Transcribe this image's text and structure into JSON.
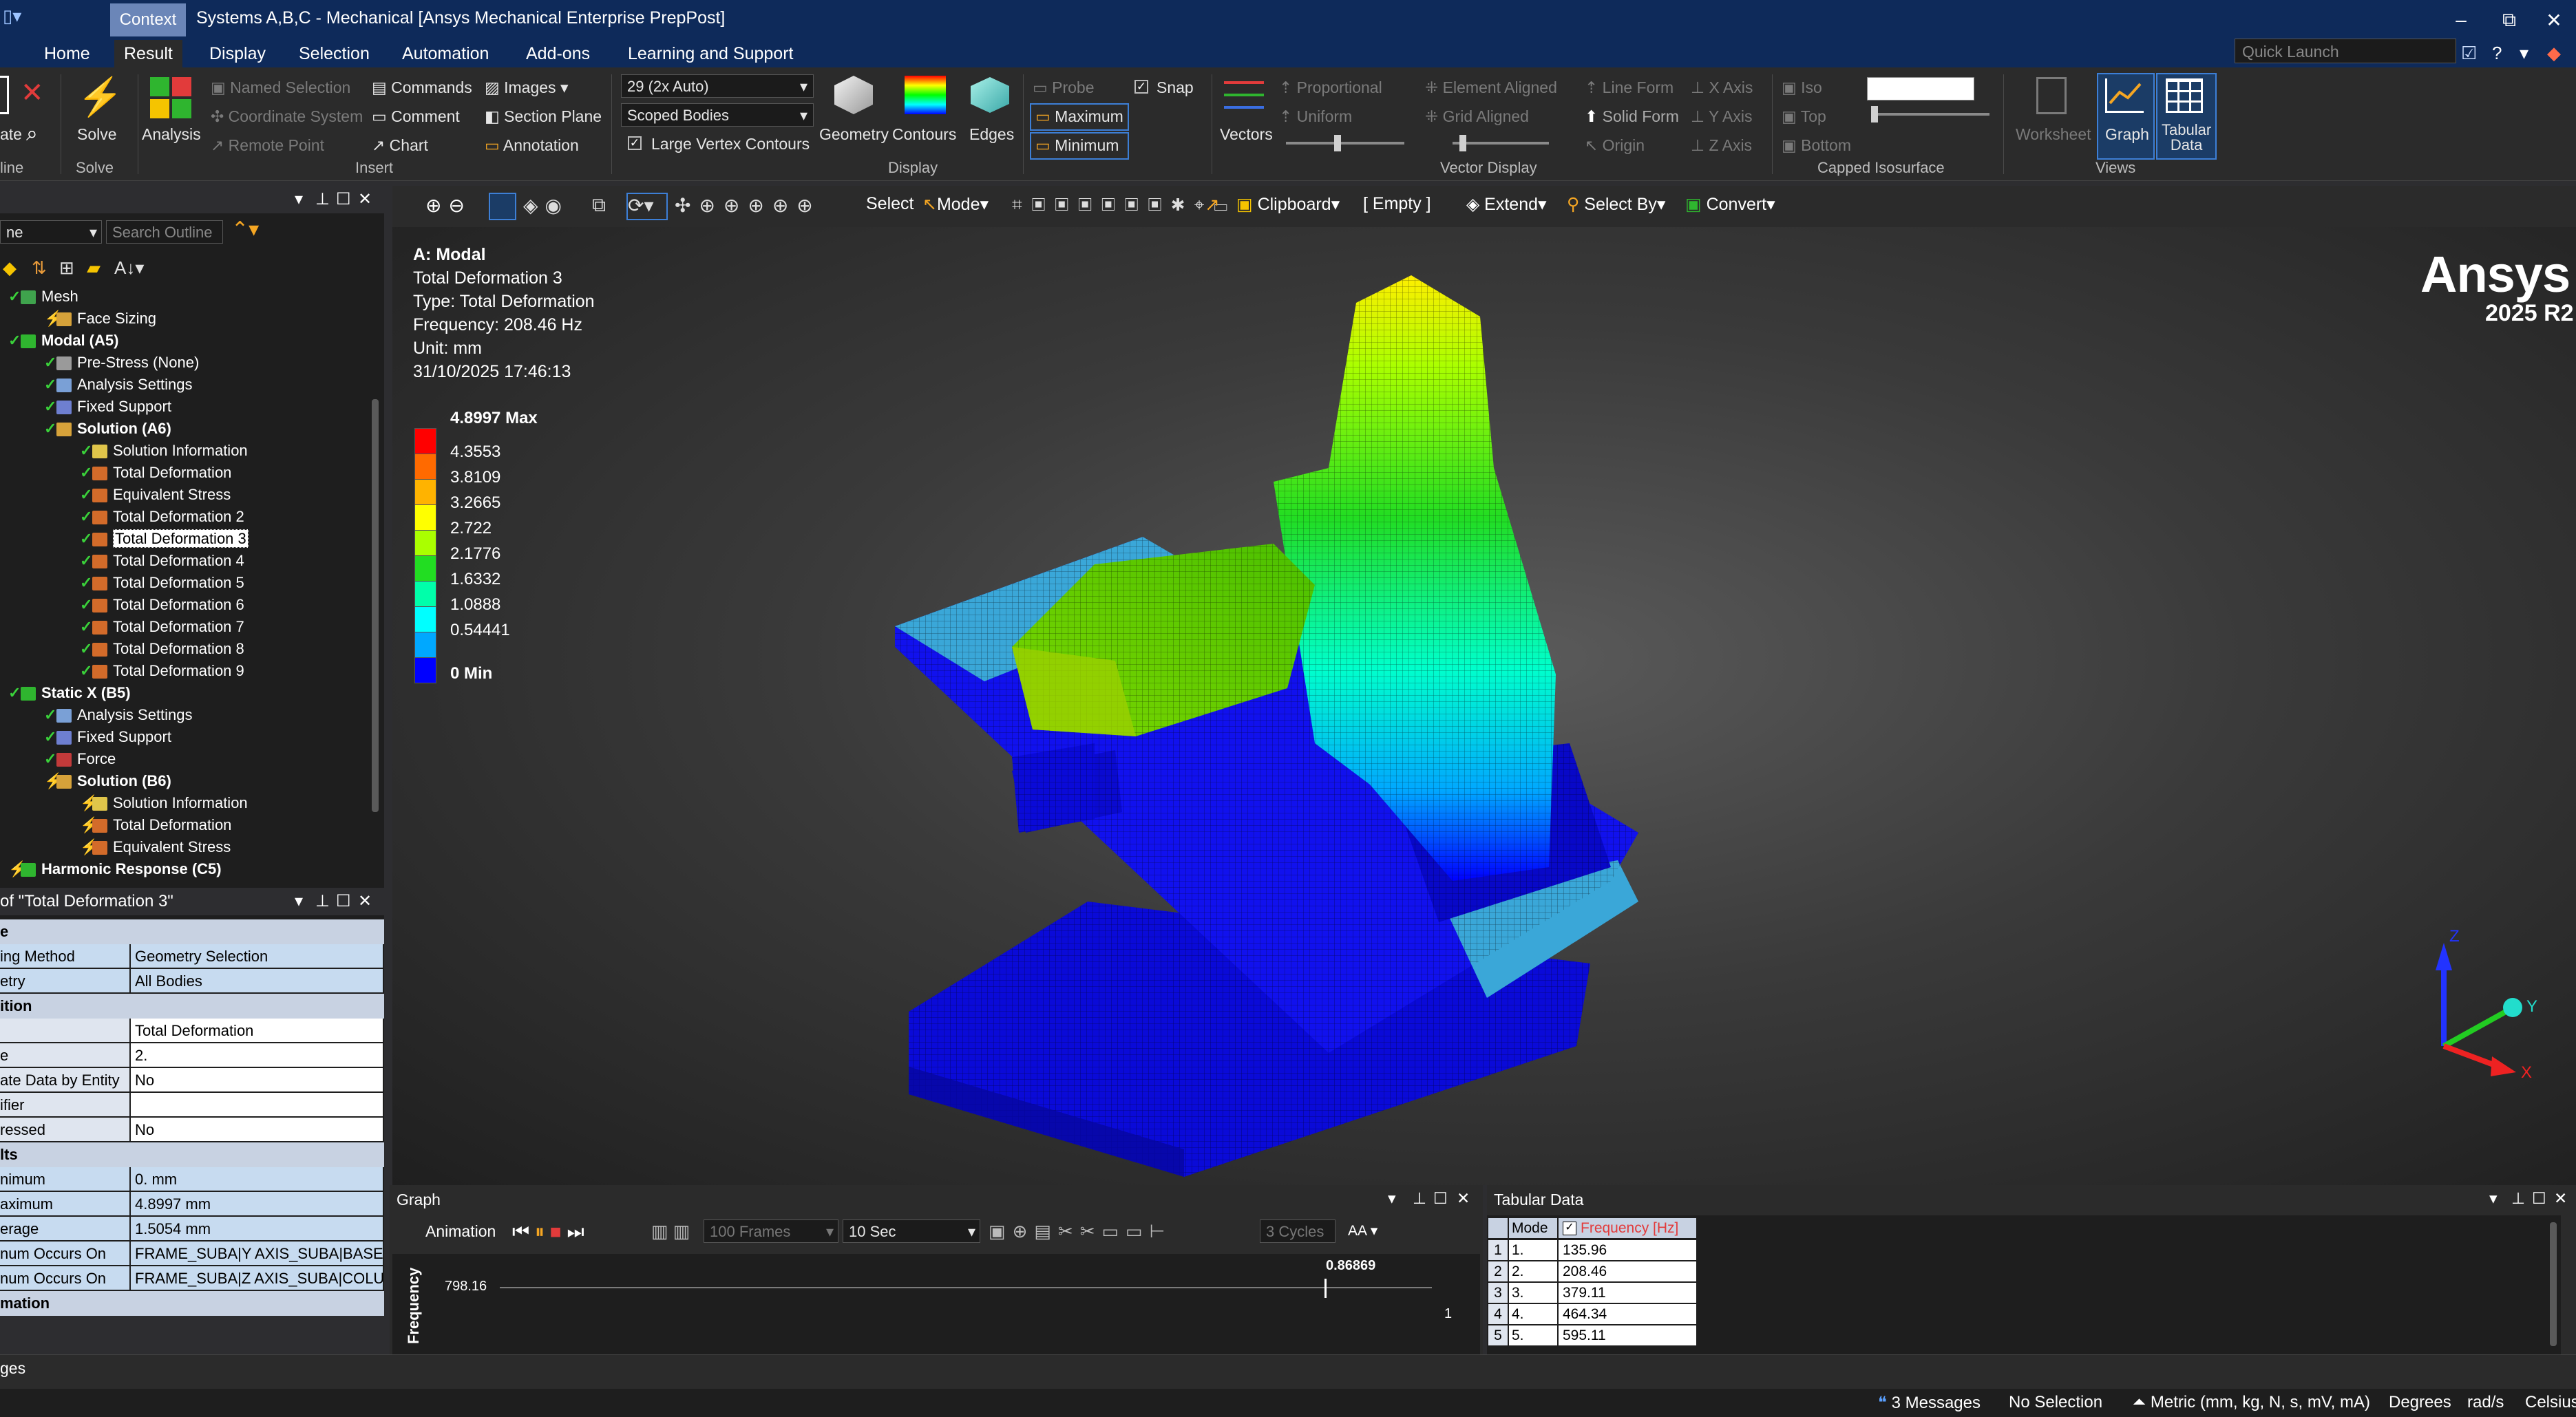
{
  "titlebar": {
    "context_tab": "Context",
    "title": "Systems A,B,C - Mechanical [Ansys Mechanical Enterprise PrepPost]"
  },
  "menu": {
    "tabs": [
      "Home",
      "Result",
      "Display",
      "Selection",
      "Automation",
      "Add-ons",
      "Learning and Support"
    ],
    "active": "Result",
    "quick_launch_placeholder": "Quick Launch"
  },
  "ribbon": {
    "outline_partial": {
      "update_label": "ate",
      "group": "line"
    },
    "solve": {
      "label": "Solve",
      "group": "Solve"
    },
    "analysis_label": "Analysis",
    "insert": {
      "named_selection": "Named Selection",
      "coordinate_system": "Coordinate System",
      "remote_point": "Remote Point",
      "commands": "Commands",
      "comment": "Comment",
      "chart": "Chart",
      "images": "Images",
      "section_plane": "Section Plane",
      "annotation": "Annotation",
      "group": "Insert"
    },
    "display": {
      "scale_value": "29 (2x Auto)",
      "scope_value": "Scoped Bodies",
      "large_vertex_contours": "Large Vertex Contours",
      "geometry": "Geometry",
      "contours": "Contours",
      "edges": "Edges",
      "group": "Display"
    },
    "probe": {
      "probe": "Probe",
      "snap": "Snap",
      "maximum": "Maximum",
      "minimum": "Minimum"
    },
    "vector_display": {
      "vectors": "Vectors",
      "proportional": "Proportional",
      "uniform": "Uniform",
      "element_aligned": "Element Aligned",
      "grid_aligned": "Grid Aligned",
      "line_form": "Line Form",
      "solid_form": "Solid Form",
      "origin": "Origin",
      "x_axis": "X Axis",
      "y_axis": "Y Axis",
      "z_axis": "Z Axis",
      "group": "Vector Display"
    },
    "capped_isosurface": {
      "iso": "Iso",
      "top": "Top",
      "bottom": "Bottom",
      "group": "Capped Isosurface"
    },
    "views": {
      "worksheet": "Worksheet",
      "graph": "Graph",
      "tabular_line1": "Tabular",
      "tabular_line2": "Data",
      "group": "Views"
    }
  },
  "outline": {
    "dropdown_value": "ne",
    "search_placeholder": "Search Outline",
    "nodes": [
      {
        "label": "Mesh",
        "bold": false,
        "check": true,
        "color": "#3fa34d"
      },
      {
        "label": "Face Sizing",
        "bold": false,
        "check": false,
        "color": "#d6a23a"
      },
      {
        "label": "Modal (A5)",
        "bold": true,
        "check": true,
        "color": "#2fb52f"
      },
      {
        "label": "Pre-Stress (None)",
        "bold": false,
        "check": true,
        "color": "#9a9a9a"
      },
      {
        "label": "Analysis Settings",
        "bold": false,
        "check": true,
        "color": "#7aa0d6"
      },
      {
        "label": "Fixed Support",
        "bold": false,
        "check": true,
        "color": "#6e7fd0"
      },
      {
        "label": "Solution (A6)",
        "bold": true,
        "check": true,
        "color": "#d6a23a"
      },
      {
        "label": "Solution Information",
        "bold": false,
        "check": true,
        "color": "#e0c54a"
      },
      {
        "label": "Total Deformation",
        "bold": false,
        "check": true,
        "color": "#d36b2a"
      },
      {
        "label": "Equivalent Stress",
        "bold": false,
        "check": true,
        "color": "#d36b2a"
      },
      {
        "label": "Total Deformation 2",
        "bold": false,
        "check": true,
        "color": "#d36b2a"
      },
      {
        "label": "Total Deformation 3",
        "bold": false,
        "check": true,
        "color": "#d36b2a",
        "selected": true
      },
      {
        "label": "Total Deformation 4",
        "bold": false,
        "check": true,
        "color": "#d36b2a"
      },
      {
        "label": "Total Deformation 5",
        "bold": false,
        "check": true,
        "color": "#d36b2a"
      },
      {
        "label": "Total Deformation 6",
        "bold": false,
        "check": true,
        "color": "#d36b2a"
      },
      {
        "label": "Total Deformation 7",
        "bold": false,
        "check": true,
        "color": "#d36b2a"
      },
      {
        "label": "Total Deformation 8",
        "bold": false,
        "check": true,
        "color": "#d36b2a"
      },
      {
        "label": "Total Deformation 9",
        "bold": false,
        "check": true,
        "color": "#d36b2a"
      },
      {
        "label": "Static X (B5)",
        "bold": true,
        "check": true,
        "color": "#2fb52f"
      },
      {
        "label": "Analysis Settings",
        "bold": false,
        "check": true,
        "color": "#7aa0d6"
      },
      {
        "label": "Fixed Support",
        "bold": false,
        "check": true,
        "color": "#6e7fd0"
      },
      {
        "label": "Force",
        "bold": false,
        "check": true,
        "color": "#c23a3a"
      },
      {
        "label": "Solution (B6)",
        "bold": true,
        "check": false,
        "color": "#d6a23a"
      },
      {
        "label": "Solution Information",
        "bold": false,
        "check": false,
        "color": "#e0c54a"
      },
      {
        "label": "Total Deformation",
        "bold": false,
        "check": false,
        "color": "#d36b2a"
      },
      {
        "label": "Equivalent Stress",
        "bold": false,
        "check": false,
        "color": "#d36b2a"
      },
      {
        "label": "Harmonic Response (C5)",
        "bold": true,
        "check": false,
        "color": "#2fb52f"
      }
    ]
  },
  "details": {
    "title": "of \"Total Deformation 3\"",
    "rows": [
      {
        "k": "e",
        "v": "",
        "hdr": true
      },
      {
        "k": "ing Method",
        "v": "Geometry Selection",
        "blue": true
      },
      {
        "k": "etry",
        "v": "All Bodies",
        "blue": true
      },
      {
        "k": "ition",
        "v": "",
        "hdr": true
      },
      {
        "k": "",
        "v": "Total Deformation"
      },
      {
        "k": "e",
        "v": "2."
      },
      {
        "k": "ate Data by Entity",
        "v": "No"
      },
      {
        "k": "ifier",
        "v": ""
      },
      {
        "k": "ressed",
        "v": "No"
      },
      {
        "k": "lts",
        "v": "",
        "hdr": true
      },
      {
        "k": "nimum",
        "v": "0. mm",
        "blue": true
      },
      {
        "k": "aximum",
        "v": "4.8997 mm",
        "blue": true
      },
      {
        "k": "erage",
        "v": "1.5054 mm",
        "blue": true
      },
      {
        "k": "num Occurs On",
        "v": "FRAME_SUBA|Y AXIS_SUBA|BASE|...",
        "blue": true
      },
      {
        "k": "num Occurs On",
        "v": "FRAME_SUBA|Z AXIS_SUBA|COLU...",
        "blue": true
      },
      {
        "k": "mation",
        "v": "",
        "hdr": true
      }
    ]
  },
  "graphics_toolbar": {
    "select": "Select",
    "mode": "Mode",
    "clipboard": "Clipboard",
    "empty": "[ Empty ]",
    "extend": "Extend",
    "select_by": "Select By",
    "convert": "Convert"
  },
  "viewport": {
    "info": {
      "title": "A: Modal",
      "result": "Total Deformation 3",
      "type": "Type: Total Deformation",
      "frequency": "Frequency: 208.46 Hz",
      "unit": "Unit: mm",
      "timestamp": "31/10/2025 17:46:13"
    },
    "legend": [
      {
        "label": "4.8997 Max",
        "color": "#ff0000",
        "bold": true
      },
      {
        "label": "4.3553",
        "color": "#ff6a00",
        "bold": false
      },
      {
        "label": "3.8109",
        "color": "#ffb300",
        "bold": false
      },
      {
        "label": "3.2665",
        "color": "#ffff00",
        "bold": false
      },
      {
        "label": "2.722",
        "color": "#aaff00",
        "bold": false
      },
      {
        "label": "2.1776",
        "color": "#22dd22",
        "bold": false
      },
      {
        "label": "1.6332",
        "color": "#00ffaa",
        "bold": false
      },
      {
        "label": "1.0888",
        "color": "#00ffff",
        "bold": false
      },
      {
        "label": "0.54441",
        "color": "#00a8ff",
        "bold": false
      },
      {
        "label": "0 Min",
        "color": "#0000ff",
        "bold": true
      }
    ],
    "brand": "Ansys",
    "version": "2025 R2",
    "triad": {
      "x": "X",
      "y": "Y",
      "z": "Z"
    }
  },
  "graph_panel": {
    "title": "Graph",
    "animation": "Animation",
    "frames": "100 Frames",
    "duration": "10 Sec",
    "cycles": "3 Cycles",
    "aa": "AA",
    "y_label": "Frequency",
    "y_value": "798.16",
    "marker_value": "0.86869",
    "x_end": "1"
  },
  "tabular_panel": {
    "title": "Tabular Data",
    "col_mode": "Mode",
    "col_freq": "Frequency [Hz]",
    "rows": [
      {
        "n": "1",
        "mode": "1.",
        "freq": "135.96"
      },
      {
        "n": "2",
        "mode": "2.",
        "freq": "208.46"
      },
      {
        "n": "3",
        "mode": "3.",
        "freq": "379.11"
      },
      {
        "n": "4",
        "mode": "4.",
        "freq": "464.34"
      },
      {
        "n": "5",
        "mode": "5.",
        "freq": "595.11"
      }
    ]
  },
  "messages_bar": {
    "label": "ges"
  },
  "status": {
    "messages": "3 Messages",
    "selection": "No Selection",
    "units": "Metric (mm, kg, N, s, mV, mA)",
    "angle": "Degrees",
    "rate": "rad/s",
    "temp": "Celsius"
  }
}
